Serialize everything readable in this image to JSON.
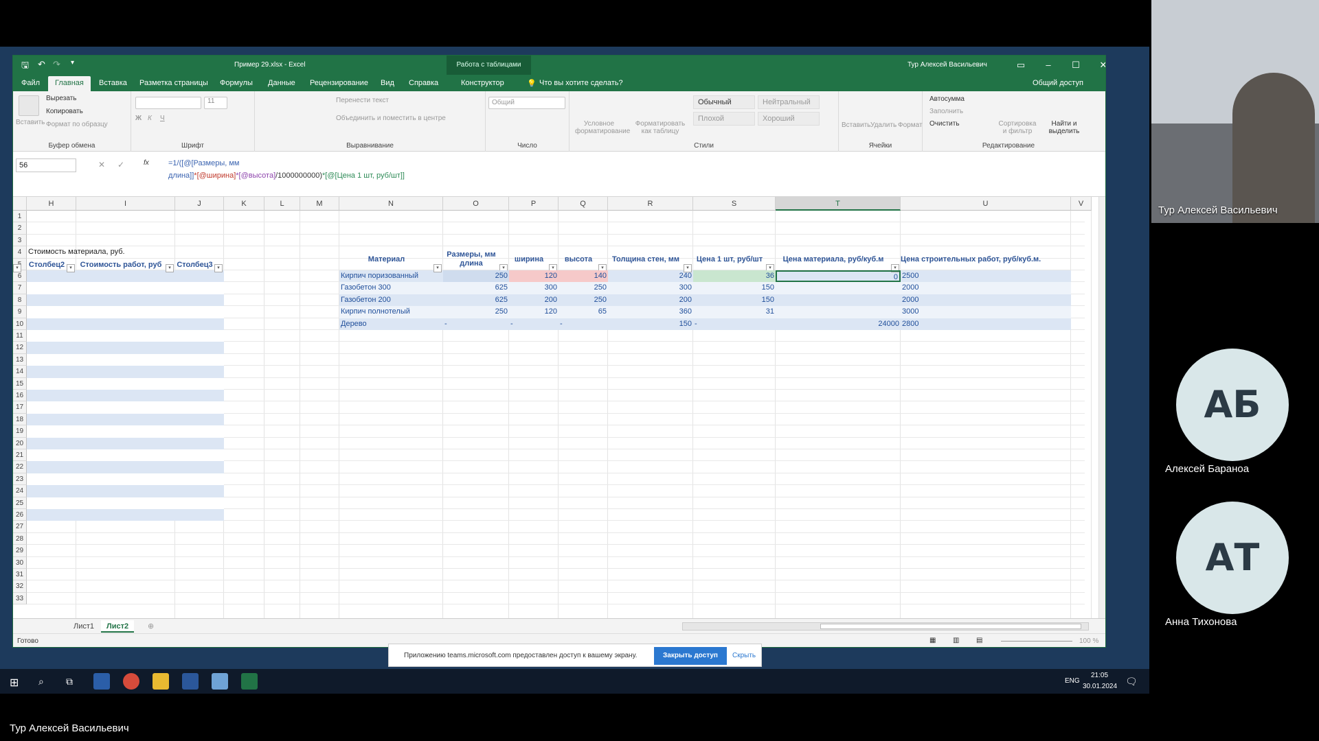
{
  "window": {
    "title": "Пример 29.xlsx  -  Excel",
    "context_tab": "Работа с таблицами",
    "user": "Тур Алексей Васильевич"
  },
  "tabs": [
    "Файл",
    "Главная",
    "Вставка",
    "Разметка страницы",
    "Формулы",
    "Данные",
    "Рецензирование",
    "Вид",
    "Справка",
    "Конструктор"
  ],
  "tellme": "Что вы хотите сделать?",
  "share": "Общий доступ",
  "ribbon": {
    "clipboard": {
      "paste": "Вставить",
      "cut": "Вырезать",
      "copy": "Копировать",
      "format": "Формат по образцу",
      "label": "Буфер обмена"
    },
    "font": {
      "size": "11",
      "label": "Шрифт"
    },
    "align": {
      "wrap": "Перенести текст",
      "merge": "Объединить и поместить в центре",
      "label": "Выравнивание"
    },
    "number": {
      "format": "Общий",
      "label": "Число"
    },
    "styles": {
      "cond": "Условное форматирование",
      "table": "Форматировать как таблицу",
      "normal": "Обычный",
      "neutral": "Нейтральный",
      "bad": "Плохой",
      "good": "Хороший",
      "label": "Стили"
    },
    "cells": {
      "insert": "Вставить",
      "delete": "Удалить",
      "format": "Формат",
      "label": "Ячейки"
    },
    "edit": {
      "autosum": "Автосумма",
      "fill": "Заполнить",
      "clear": "Очистить",
      "sort": "Сортировка и фильтр",
      "find": "Найти и выделить",
      "label": "Редактирование"
    }
  },
  "namebox": "56",
  "formula": {
    "p1": "=1/([@[Размеры, мм",
    "p2": "длина]]",
    "p3": "*[@ширина]",
    "p4": "*[@высота]",
    "p5": "/1000000000)",
    "p6": "*[@[Цена 1 шт, руб/шт]]"
  },
  "columns": [
    "H",
    "I",
    "J",
    "K",
    "L",
    "M",
    "N",
    "O",
    "P",
    "Q",
    "R",
    "S",
    "T",
    "U",
    "V"
  ],
  "rows": [
    "1",
    "2",
    "3",
    "4",
    "5",
    "6",
    "7",
    "8",
    "9",
    "10",
    "11",
    "12",
    "13",
    "14",
    "15",
    "16",
    "17",
    "18",
    "19",
    "20",
    "21",
    "22",
    "23",
    "24",
    "25",
    "26",
    "27",
    "28",
    "29",
    "30",
    "31",
    "32",
    "33"
  ],
  "left_table": {
    "title": "Стоимость материала, руб.",
    "headers": [
      "Столбец2",
      "Стоимость работ, руб",
      "Столбец3"
    ]
  },
  "main_table": {
    "headers": [
      "Материал",
      "Размеры, мм длина",
      "ширина",
      "высота",
      "Толщина стен, мм",
      "Цена 1 шт, руб/шт",
      "Цена материала, руб/куб.м",
      "Цена строительных работ, руб/куб.м."
    ],
    "rows": [
      [
        "Кирпич поризованный",
        "250",
        "120",
        "140",
        "240",
        "36",
        "0",
        "2500"
      ],
      [
        "Газобетон 300",
        "625",
        "300",
        "250",
        "300",
        "150",
        "",
        "2000"
      ],
      [
        "Газобетон 200",
        "625",
        "200",
        "250",
        "200",
        "150",
        "",
        "2000"
      ],
      [
        "Кирпич полнотелый",
        "250",
        "120",
        "65",
        "360",
        "31",
        "",
        "3000"
      ],
      [
        "Дерево",
        "-",
        "-",
        "-",
        "150",
        "-",
        "24000",
        "2800"
      ]
    ]
  },
  "sheets": [
    "Лист1",
    "Лист2"
  ],
  "status": {
    "ready": "Готово",
    "zoom": "100 %"
  },
  "teams": {
    "msg": "Приложению teams.microsoft.com предоставлен доступ к вашему экрану.",
    "stop": "Закрыть доступ",
    "hide": "Скрыть"
  },
  "taskbar": {
    "lang": "ENG",
    "time": "21:05",
    "date": "30.01.2024"
  },
  "participants": [
    {
      "initials": "",
      "name": "Тур Алексей Васильевич"
    },
    {
      "initials": "АБ",
      "name": "Алексей Бараноа"
    },
    {
      "initials": "АТ",
      "name": "Анна Тихонова"
    }
  ],
  "presenter": "Тур Алексей Васильевич"
}
